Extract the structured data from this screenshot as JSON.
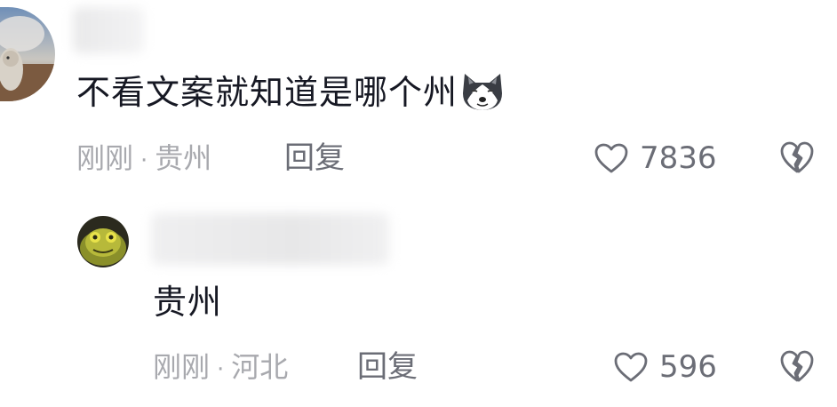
{
  "comments": [
    {
      "text": "不看文案就知道是哪个州",
      "time": "刚刚",
      "separator": "·",
      "location": "贵州",
      "reply_label": "回复",
      "like_count": "7836",
      "emoji": "husky-emoji-icon"
    },
    {
      "text": "贵州",
      "time": "刚刚",
      "separator": "·",
      "location": "河北",
      "reply_label": "回复",
      "like_count": "596"
    }
  ],
  "colors": {
    "text": "#161823",
    "meta": "#a8a9ae",
    "action": "#6b6d76",
    "background": "#ffffff"
  }
}
